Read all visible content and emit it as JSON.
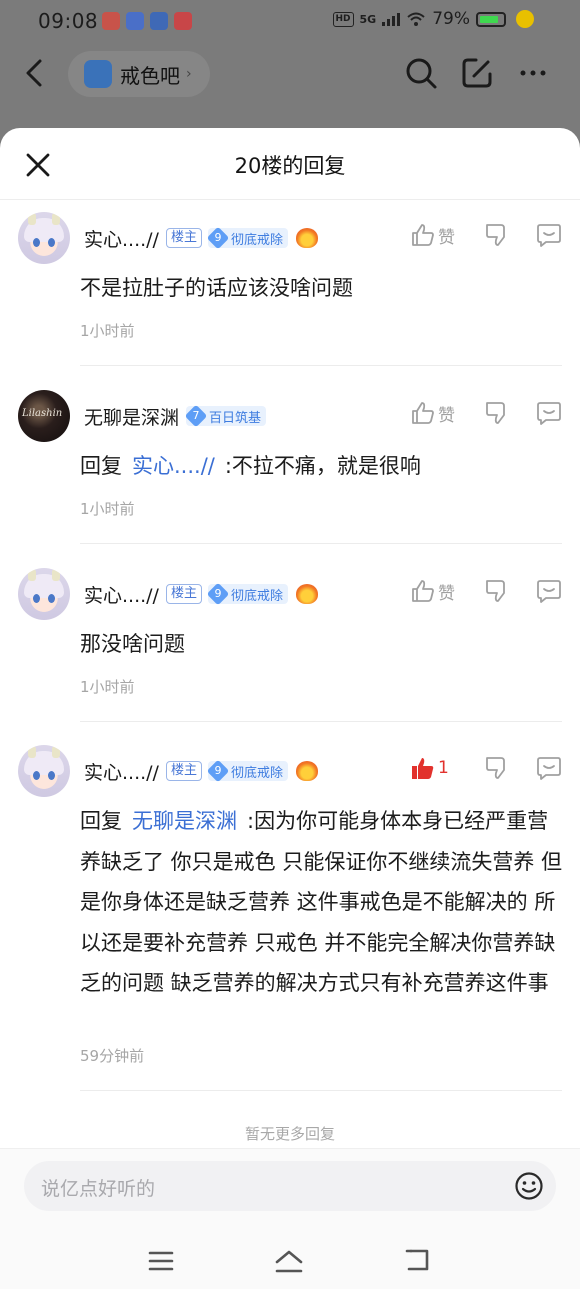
{
  "status_bar": {
    "time": "09:08",
    "hd": "HD",
    "network": "5G",
    "battery": "79%"
  },
  "forum": {
    "name": "戒色吧"
  },
  "sheet": {
    "title": "20楼的回复"
  },
  "labels": {
    "like": "赞",
    "owner_tag": "楼主"
  },
  "comments": [
    {
      "username": "实心....//",
      "is_owner": true,
      "level": "9",
      "level_name": "彻底戒除",
      "text": "不是拉肚子的话应该没啥问题",
      "time": "1小时前",
      "likes": ""
    },
    {
      "username": "无聊是深渊",
      "is_owner": false,
      "level": "7",
      "level_name": "百日筑基",
      "reply_prefix": "回复",
      "reply_target": "实心....//",
      "text": ":不拉不痛，就是很响",
      "time": "1小时前",
      "likes": ""
    },
    {
      "username": "实心....//",
      "is_owner": true,
      "level": "9",
      "level_name": "彻底戒除",
      "text": "那没啥问题",
      "time": "1小时前",
      "likes": ""
    },
    {
      "username": "实心....//",
      "is_owner": true,
      "level": "9",
      "level_name": "彻底戒除",
      "reply_prefix": "回复",
      "reply_target": "无聊是深渊",
      "text": ":因为你可能身体本身已经严重营养缺乏了 你只是戒色 只能保证你不继续流失营养 但是你身体还是缺乏营养 这件事戒色是不能解决的 所以还是要补充营养 只戒色 并不能完全解决你营养缺乏的问题 缺乏营养的解决方式只有补充营养这件事",
      "time": "59分钟前",
      "likes": "1"
    }
  ],
  "footer": {
    "no_more": "暂无更多回复",
    "input_placeholder": "说亿点好听的"
  },
  "colors": {
    "accent_blue": "#3b6fd4",
    "like_red": "#e2322d",
    "muted_gray": "#a6a6a6"
  }
}
